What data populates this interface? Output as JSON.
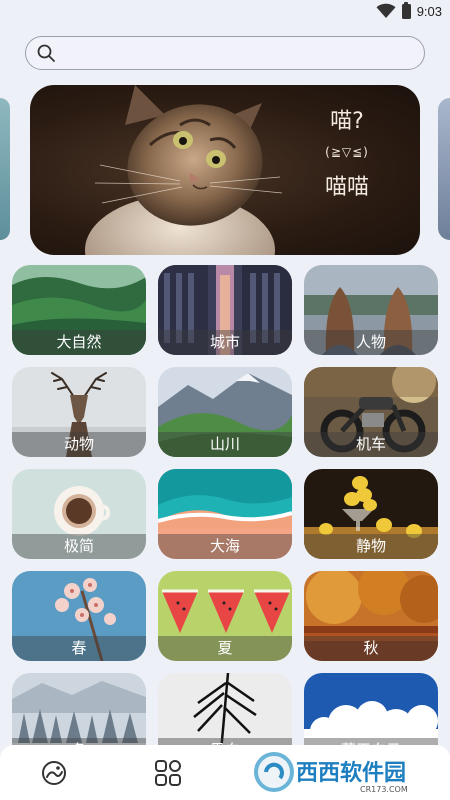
{
  "status_bar": {
    "time": "9:03"
  },
  "search": {
    "placeholder": ""
  },
  "banner": {
    "line1": "喵?",
    "face": "(≧▽≦)",
    "line2": "喵喵"
  },
  "categories": [
    {
      "label": "大自然",
      "theme": "forest"
    },
    {
      "label": "城市",
      "theme": "city"
    },
    {
      "label": "人物",
      "theme": "people"
    },
    {
      "label": "动物",
      "theme": "deer"
    },
    {
      "label": "山川",
      "theme": "mountains"
    },
    {
      "label": "机车",
      "theme": "motorbike"
    },
    {
      "label": "极简",
      "theme": "coffee"
    },
    {
      "label": "大海",
      "theme": "beach"
    },
    {
      "label": "静物",
      "theme": "lemons"
    },
    {
      "label": "春",
      "theme": "blossom"
    },
    {
      "label": "夏",
      "theme": "watermelon"
    },
    {
      "label": "秋",
      "theme": "autumn"
    },
    {
      "label": "冬",
      "theme": "snow"
    },
    {
      "label": "黑白",
      "theme": "palm"
    },
    {
      "label": "蓝天白云",
      "theme": "sky"
    }
  ],
  "bottom_nav": {
    "items": [
      {
        "icon": "discover-icon"
      },
      {
        "icon": "categories-icon"
      }
    ]
  },
  "watermark": {
    "brand": "西西软件园",
    "domain": "CR173.COM"
  }
}
